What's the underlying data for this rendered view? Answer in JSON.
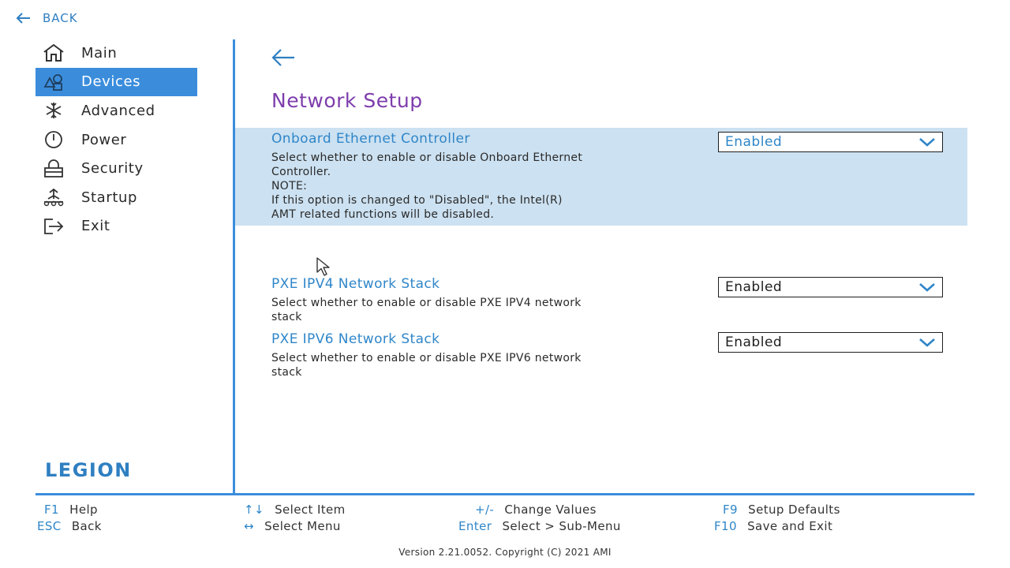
{
  "top_back": {
    "label": "BACK",
    "icon": "arrow-left-icon"
  },
  "sidebar": {
    "items": [
      {
        "label": "Main",
        "icon": "home-icon",
        "active": false
      },
      {
        "label": "Devices",
        "icon": "devices-icon",
        "active": true
      },
      {
        "label": "Advanced",
        "icon": "snowflake-icon",
        "active": false
      },
      {
        "label": "Power",
        "icon": "power-icon",
        "active": false
      },
      {
        "label": "Security",
        "icon": "lock-icon",
        "active": false
      },
      {
        "label": "Startup",
        "icon": "startup-icon",
        "active": false
      },
      {
        "label": "Exit",
        "icon": "exit-icon",
        "active": false
      }
    ],
    "logo_text": "LEGION"
  },
  "main": {
    "back_icon": "arrow-left-icon",
    "title": "Network Setup",
    "settings": [
      {
        "title": "Onboard Ethernet Controller",
        "description": [
          "Select whether to enable or disable Onboard Ethernet",
          "Controller.",
          "NOTE:",
          "If this option is changed to \"Disabled\", the Intel(R)",
          "AMT related functions will be disabled."
        ],
        "value": "Enabled",
        "highlighted": true
      },
      {
        "title": "PXE IPV4 Network Stack",
        "description": [
          "Select whether to enable or disable PXE IPV4 network",
          "stack"
        ],
        "value": "Enabled",
        "highlighted": false
      },
      {
        "title": "PXE IPV6 Network Stack",
        "description": [
          "Select whether to enable or disable PXE IPV6 network",
          "stack"
        ],
        "value": "Enabled",
        "highlighted": false
      }
    ]
  },
  "footer": {
    "hints": [
      {
        "key": "F1",
        "text": "Help"
      },
      {
        "key": "ESC",
        "text": "Back"
      },
      {
        "key": "↑↓",
        "text": "Select Item"
      },
      {
        "key": "↔",
        "text": "Select Menu"
      },
      {
        "key": "+/-",
        "text": "Change Values"
      },
      {
        "key": "Enter",
        "text": "Select > Sub-Menu"
      },
      {
        "key": "F9",
        "text": "Setup Defaults"
      },
      {
        "key": "F10",
        "text": "Save and Exit"
      }
    ],
    "version": "Version 2.21.0052. Copyright (C) 2021 AMI"
  },
  "colors": {
    "accent": "#3b8ddc",
    "link_blue": "#2f86c9",
    "title_purple": "#7e3dac",
    "highlight_bg": "#cce1f1"
  }
}
